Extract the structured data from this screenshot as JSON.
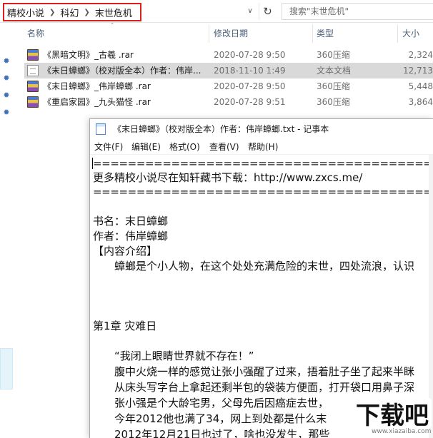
{
  "address_bar": {
    "breadcrumb": [
      "精校小说",
      "科幻",
      "末世危机"
    ],
    "search_placeholder": "搜索\"末世危机\""
  },
  "columns": {
    "name": "名称",
    "date": "修改日期",
    "type": "类型",
    "size": "大小"
  },
  "files": [
    {
      "name": "《黑暗文明》_古羲 .rar",
      "date": "2020-07-28 9:50",
      "type": "360压缩",
      "size": "2,324",
      "icon": "rar-archive-icon",
      "selected": false
    },
    {
      "name": "《末日蟑螂》（校对版全本）作者：伟岸...",
      "date": "2018-11-10 1:49",
      "type": "文本文档",
      "size": "12,713",
      "icon": "text-file-icon",
      "selected": true
    },
    {
      "name": "《末日蟑螂》_伟岸蟑螂 .rar",
      "date": "2020-07-28 9:50",
      "type": "360压缩",
      "size": "5,448",
      "icon": "rar-archive-icon",
      "selected": false
    },
    {
      "name": "《重启家园》_九头猫怪 .rar",
      "date": "2020-07-28 9:51",
      "type": "360压缩",
      "size": "3,864",
      "icon": "rar-archive-icon",
      "selected": false
    }
  ],
  "notepad": {
    "title": "《末日蟑螂》（校对版全本）作者：伟岸蟑螂.txt - 记事本",
    "menu": [
      "文件(F)",
      "编辑(E)",
      "格式(O)",
      "查看(V)",
      "帮助(H)"
    ],
    "lines": [
      "==================================================",
      "更多精校小说尽在知轩藏书下载：http://www.zxcs.me/",
      "==================================================",
      "",
      "书名：末日蟑螂",
      "作者：伟岸蟑螂",
      "【内容介绍】",
      "　　蟑螂是个小人物，在这个处处充满危险的末世，四处流浪，认识",
      "",
      "",
      "",
      "第1章 灾难日",
      "",
      "　　“我闭上眼睛世界就不存在！”",
      "　　腹中火烧一样的感觉让张小强醒了过来，捂着肚子坐了起来半眯",
      "　　从床头写字台上拿起还剩半包的袋装方便面，打开袋口用鼻子深",
      "　　张小强是个大龄宅男，父母先后因癌症去世，",
      "　　今年2012他也满了34，网上到处都是什么末",
      "　　2012年12月21日也过了，啥也没发生，那些"
    ]
  },
  "watermark": {
    "logo_text": "下载吧",
    "site": "www.xiazaiba.com"
  }
}
